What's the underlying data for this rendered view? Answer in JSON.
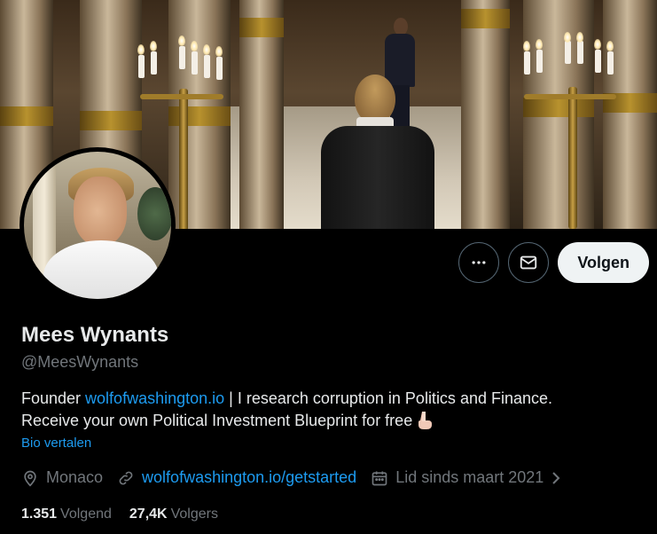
{
  "profile": {
    "name": "Mees Wynants",
    "handle": "@MeesWynants",
    "bio_prefix": "Founder ",
    "bio_link": "wolfofwashington.io",
    "bio_rest_line1": " | I research corruption in Politics and Finance.",
    "bio_line2": "Receive your own Political Investment Blueprint for free",
    "bio_emoji": "pointing-down-hand-icon",
    "translate_label": "Bio vertalen"
  },
  "actions": {
    "more_icon": "more-horizontal-icon",
    "message_icon": "envelope-icon",
    "follow_label": "Volgen"
  },
  "meta": {
    "location": "Monaco",
    "website": "wolfofwashington.io/getstarted",
    "joined": "Lid sinds maart 2021"
  },
  "stats": {
    "following_count": "1.351",
    "following_label": "Volgend",
    "followers_count": "27,4K",
    "followers_label": "Volgers"
  },
  "colors": {
    "background": "#000000",
    "text": "#e7e9ea",
    "secondary": "#71767b",
    "link": "#1d9bf0",
    "follow_bg": "#eff3f4"
  }
}
